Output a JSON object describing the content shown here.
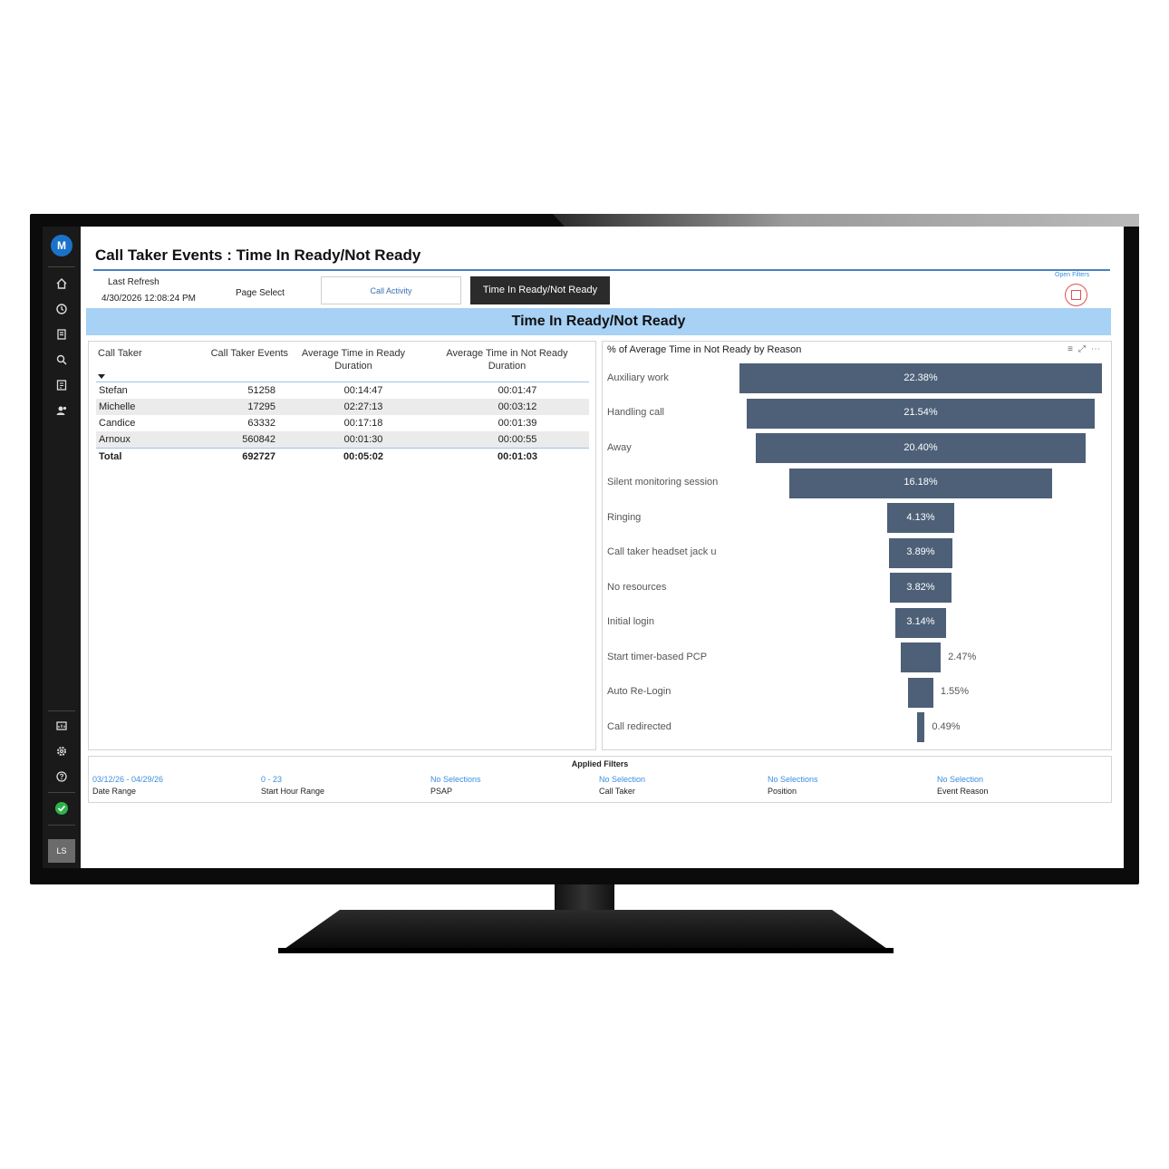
{
  "page": {
    "title": "Call Taker Events : Time In Ready/Not Ready",
    "last_refresh_label": "Last Refresh",
    "last_refresh_value": "4/30/2026 12:08:24 PM",
    "page_select_label": "Page Select",
    "nav_call_activity": "Call Activity",
    "nav_time_ready": "Time In Ready/Not Ready",
    "open_filters": "Open Filters",
    "banner": "Time In Ready/Not Ready"
  },
  "sidebar": {
    "logo": "M",
    "user_initials": "LS",
    "icons": [
      "home-icon",
      "history-icon",
      "documents-icon",
      "search-icon",
      "report-icon",
      "users-icon",
      "dashboard-icon",
      "settings-icon",
      "help-icon"
    ]
  },
  "table": {
    "headers": {
      "call_taker": "Call Taker",
      "events": "Call Taker Events",
      "ready": "Average Time in Ready Duration",
      "not_ready": "Average Time in Not Ready Duration"
    },
    "rows": [
      {
        "name": "Stefan",
        "events": "51258",
        "ready": "00:14:47",
        "not_ready": "00:01:47"
      },
      {
        "name": "Michelle",
        "events": "17295",
        "ready": "02:27:13",
        "not_ready": "00:03:12"
      },
      {
        "name": "Candice",
        "events": "63332",
        "ready": "00:17:18",
        "not_ready": "00:01:39"
      },
      {
        "name": "Arnoux",
        "events": "560842",
        "ready": "00:01:30",
        "not_ready": "00:00:55"
      }
    ],
    "total": {
      "name": "Total",
      "events": "692727",
      "ready": "00:05:02",
      "not_ready": "00:01:03"
    }
  },
  "chart_data": {
    "type": "bar",
    "title": "% of Average Time in Not Ready by Reason",
    "categories": [
      "Auxiliary work",
      "Handling call",
      "Away",
      "Silent monitoring session",
      "Ringing",
      "Call taker headset jack u",
      "No resources",
      "Initial login",
      "Start timer-based PCP",
      "Auto Re-Login",
      "Call redirected"
    ],
    "values": [
      22.38,
      21.54,
      20.4,
      16.18,
      4.13,
      3.89,
      3.82,
      3.14,
      2.47,
      1.55,
      0.49
    ],
    "labels": [
      "22.38%",
      "21.54%",
      "20.40%",
      "16.18%",
      "4.13%",
      "3.89%",
      "3.82%",
      "3.14%",
      "2.47%",
      "1.55%",
      "0.49%"
    ],
    "bar_color": "#4d6078"
  },
  "applied_filters": {
    "title": "Applied Filters",
    "items": [
      {
        "value": "03/12/26 - 04/29/26",
        "label": "Date Range"
      },
      {
        "value": "0 - 23",
        "label": "Start Hour Range"
      },
      {
        "value": "No Selections",
        "label": "PSAP"
      },
      {
        "value": "No Selection",
        "label": "Call Taker"
      },
      {
        "value": "No Selections",
        "label": "Position"
      },
      {
        "value": "No Selection",
        "label": "Event Reason"
      }
    ]
  }
}
